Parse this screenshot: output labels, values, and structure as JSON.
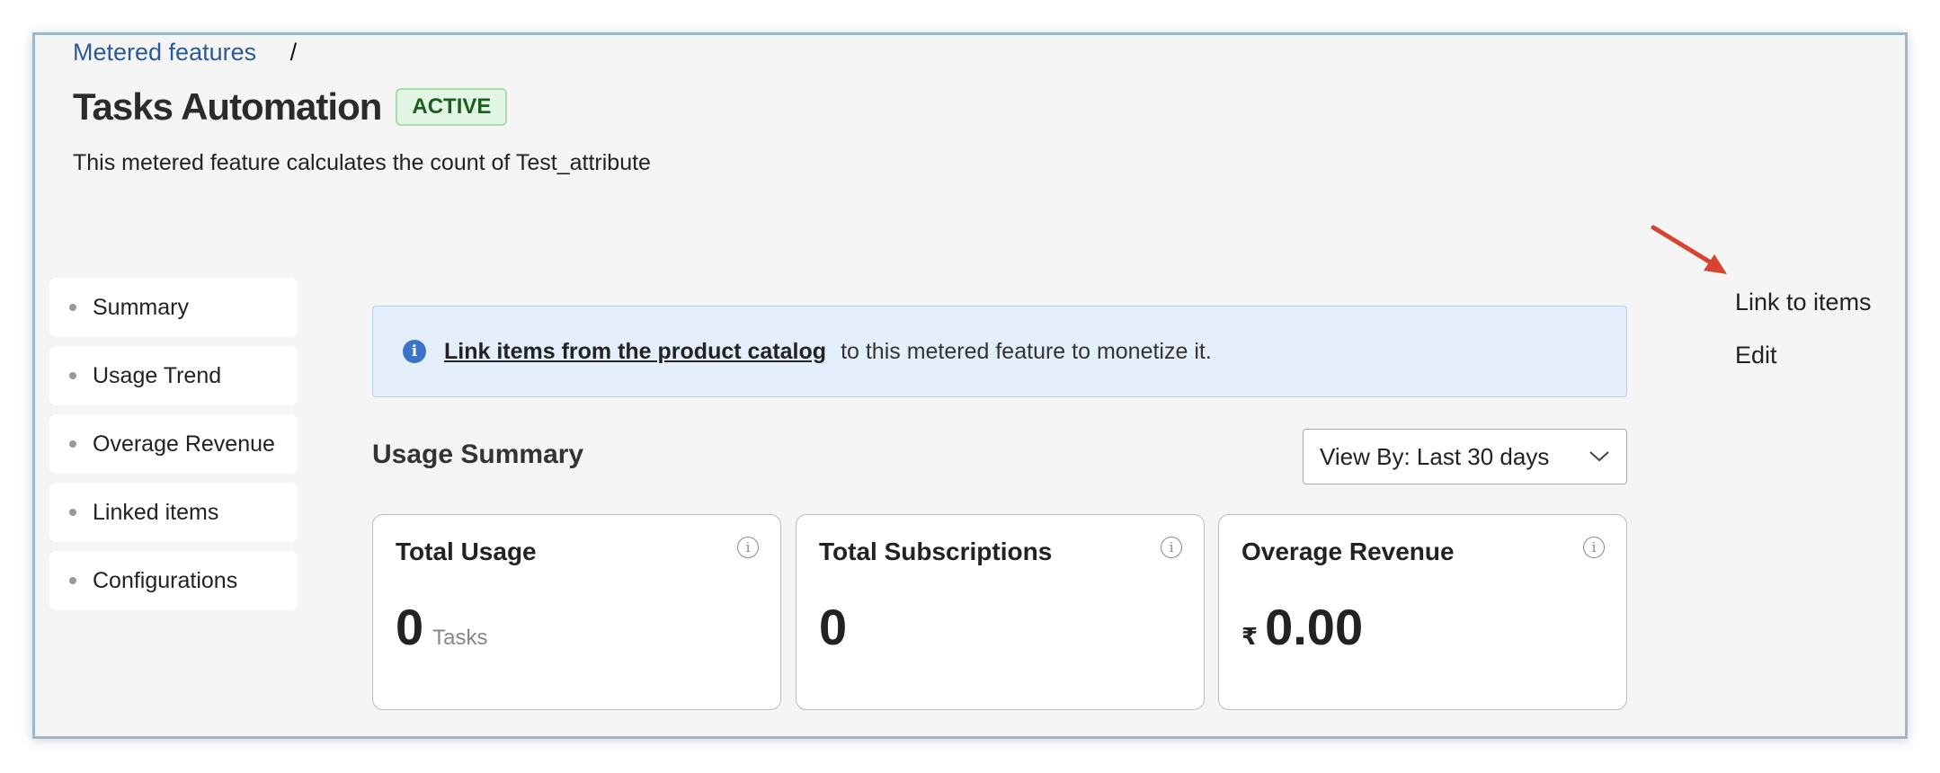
{
  "breadcrumb": {
    "parent": "Metered features",
    "separator": "/"
  },
  "header": {
    "title": "Tasks Automation",
    "status": "ACTIVE",
    "description": "This metered feature calculates the count of Test_attribute"
  },
  "sidebar": {
    "items": [
      {
        "label": "Summary"
      },
      {
        "label": "Usage Trend"
      },
      {
        "label": "Overage Revenue"
      },
      {
        "label": "Linked items"
      },
      {
        "label": "Configurations"
      }
    ]
  },
  "actions": {
    "link_to_items": "Link to items",
    "edit": "Edit"
  },
  "banner": {
    "link_text": "Link items from the product catalog",
    "text": "to this metered feature to monetize it."
  },
  "usage_summary": {
    "title": "Usage Summary",
    "view_by": "View By: Last 30 days"
  },
  "cards": [
    {
      "title": "Total Usage",
      "value": "0",
      "unit": "Tasks"
    },
    {
      "title": "Total Subscriptions",
      "value": "0"
    },
    {
      "title": "Overage Revenue",
      "currency": "₹",
      "value": "0.00"
    }
  ],
  "colors": {
    "accent": "#2a5a9a",
    "status_bg": "#e3f6e3",
    "banner_bg": "#e4effb",
    "annotation_arrow": "#d9432f"
  }
}
